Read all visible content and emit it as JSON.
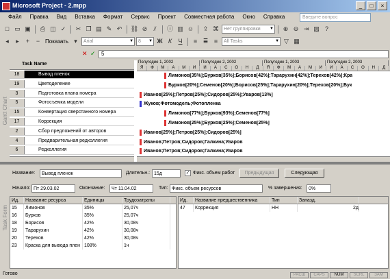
{
  "window": {
    "title": "Microsoft Project - 2.mpp"
  },
  "menu": [
    "Файл",
    "Правка",
    "Вид",
    "Вставка",
    "Формат",
    "Сервис",
    "Проект",
    "Совместная работа",
    "Окно",
    "Справка"
  ],
  "help_placeholder": "Введите вопрос",
  "toolbar": {
    "grouping": "Нет группировки",
    "show_label": "Показать",
    "font": "Arial",
    "font_size": "8",
    "filter": "All Tasks"
  },
  "entry_value": "5",
  "gantt": {
    "side_label": "Gantt Chart",
    "header": "Task Name",
    "tasks": [
      {
        "id": "18",
        "name": "Вывод пленок",
        "selected": true
      },
      {
        "id": "19",
        "name": "Цветоделение",
        "selected": false
      },
      {
        "id": "3",
        "name": "Подготовка плана номера",
        "selected": false
      },
      {
        "id": "5",
        "name": "Фотосъемка модели",
        "selected": false
      },
      {
        "id": "15",
        "name": "Конвертация сверстанного номера",
        "selected": false
      },
      {
        "id": "17",
        "name": "Коррекция",
        "selected": false
      },
      {
        "id": "2",
        "name": "Сбор предложений от авторов",
        "selected": false
      },
      {
        "id": "4",
        "name": "Предварительная редколлегия",
        "selected": false
      },
      {
        "id": "6",
        "name": "Редколлегия",
        "selected": false
      }
    ],
    "timescale_top": [
      "Полугодие 1, 2002",
      "Полугодие 2, 2002",
      "Полугодие 1, 2003",
      "Полугодие 2, 2003"
    ],
    "timescale_months": [
      "Я",
      "Ф",
      "М",
      "А",
      "М",
      "И",
      "И",
      "А",
      "С",
      "О",
      "Н",
      "Д",
      "Я",
      "Ф",
      "М",
      "А",
      "М",
      "И",
      "И",
      "А",
      "С",
      "О",
      "Н",
      "Д"
    ],
    "bar_labels": [
      "Лимонов[35%];Бурков[35%];Борисов[42%];Тарарухин[42%];Терехов[42%];Кра",
      "Бурков[20%];Семенов[20%];Борисов[25%];Тарарухин[20%];Терехов[20%];Бук",
      "Иванов[25%];Петров[25%];Сидоров[25%];Уваров[13%]",
      "Жуков;Фотомодель;Фотопленка",
      "Лимонов[77%];Бурков[93%];Семенов[77%]",
      "Лимонов[25%];Бурков[25%];Семенов[25%]",
      "Иванов[25%];Петров[25%];Сидоров[25%]",
      "Иванов;Петров;Сидоров;Галкина;Уваров",
      "Иванов;Петров;Сидоров;Галкина;Уваров"
    ]
  },
  "form": {
    "side_label": "Task Form",
    "name_label": "Название:",
    "name_value": "Вывод пленок",
    "duration_label": "Длительн.:",
    "duration_value": "15д",
    "effort_label": "Фикс. объем работ",
    "prev_button": "Предыдущая",
    "next_button": "Следующая",
    "start_label": "Начало:",
    "start_value": "Пт 29.03.02",
    "finish_label": "Окончание:",
    "finish_value": "Чт 11.04.02",
    "type_label": "Тип:",
    "type_value": "Фикс. объем ресурсов",
    "complete_label": "% завершения:",
    "complete_value": "0%",
    "resources_headers": [
      "Ид.",
      "Название ресурса",
      "Единицы",
      "Трудозатраты"
    ],
    "resources": [
      [
        "15",
        "Лимонов",
        "35%",
        "25,07ч"
      ],
      [
        "16",
        "Бурков",
        "35%",
        "25,07ч"
      ],
      [
        "18",
        "Борисов",
        "42%",
        "30,08ч"
      ],
      [
        "19",
        "Тарарухин",
        "42%",
        "30,08ч"
      ],
      [
        "20",
        "Терехов",
        "42%",
        "30,08ч"
      ],
      [
        "23",
        "Краска для вывода плен",
        "108%",
        "1ч"
      ]
    ],
    "pred_headers": [
      "Ид.",
      "Название предшественника",
      "Тип",
      "Запазд."
    ],
    "predecessors": [
      [
        "47",
        "Коррекция",
        "НН",
        "2д"
      ]
    ]
  },
  "status": {
    "text": "Готово",
    "indicators": [
      "РАСШ",
      "CAPS",
      "NUM",
      "SCRL",
      "ЗАМ"
    ]
  }
}
